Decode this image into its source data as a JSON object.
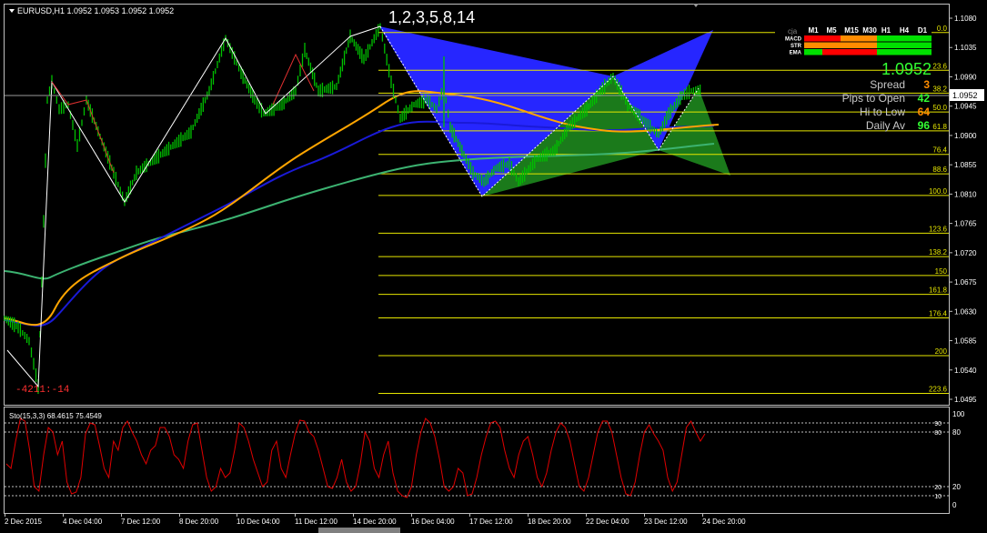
{
  "header": {
    "symbol_line": "EURUSD,H1  1.0952 1.0953 1.0952 1.0952",
    "pattern_title": "1,2,3,5,8,14",
    "zigzag_label": "-4211:-14"
  },
  "price_axis": {
    "ticks": [
      "1.1080",
      "1.1035",
      "1.0990",
      "1.0945",
      "1.0900",
      "1.0855",
      "1.0810",
      "1.0765",
      "1.0720",
      "1.0675",
      "1.0630",
      "1.0585",
      "1.0540",
      "1.0495"
    ],
    "current_price": "1.0952"
  },
  "fib_levels": [
    {
      "label": "0.0",
      "price": 1.1058
    },
    {
      "label": "23.6",
      "price": 1.1
    },
    {
      "label": "38.2",
      "price": 1.0965
    },
    {
      "label": "50.0",
      "price": 1.0936
    },
    {
      "label": "61.8",
      "price": 1.0907
    },
    {
      "label": "76.4",
      "price": 1.0871
    },
    {
      "label": "88.6",
      "price": 1.0841
    },
    {
      "label": "100.0",
      "price": 1.0808
    },
    {
      "label": "123.6",
      "price": 1.075
    },
    {
      "label": "138.2",
      "price": 1.0714
    },
    {
      "label": "150",
      "price": 1.0685
    },
    {
      "label": "161.8",
      "price": 1.0656
    },
    {
      "label": "176.4",
      "price": 1.062
    },
    {
      "label": "200",
      "price": 1.0562
    },
    {
      "label": "223.6",
      "price": 1.0504
    }
  ],
  "info_panel": {
    "big_price": "1.0952",
    "rows": [
      {
        "label": "Spread",
        "value": "3"
      },
      {
        "label": "Pips to Open",
        "value": "42"
      },
      {
        "label": "Hi to Low",
        "value": "64"
      },
      {
        "label": "Daily Av",
        "value": "96"
      }
    ]
  },
  "signal_grid": {
    "cja_label": "cja",
    "timeframes": [
      "M1",
      "M5",
      "M15",
      "M30",
      "H1",
      "H4",
      "D1"
    ],
    "rows": [
      {
        "name": "MACD",
        "cells": [
          "red",
          "red",
          "orange",
          "orange",
          "green",
          "green",
          "green"
        ]
      },
      {
        "name": "STR",
        "cells": [
          "orange",
          "orange",
          "orange",
          "orange",
          "green",
          "green",
          "green"
        ]
      },
      {
        "name": "EMA",
        "cells": [
          "green",
          "red",
          "red",
          "red",
          "green",
          "green",
          "green"
        ]
      }
    ],
    "colors": {
      "red": "#ff0000",
      "orange": "#ff8c00",
      "green": "#00e000"
    }
  },
  "time_axis": {
    "labels": [
      "2 Dec 2015",
      "4 Dec 04:00",
      "7 Dec 12:00",
      "8 Dec 20:00",
      "10 Dec 04:00",
      "11 Dec 12:00",
      "14 Dec 20:00",
      "16 Dec 04:00",
      "17 Dec 12:00",
      "18 Dec 20:00",
      "22 Dec 04:00",
      "23 Dec 12:00",
      "24 Dec 20:00"
    ]
  },
  "stochastic": {
    "label": "Sto(15,3,3) 68.4615 75.4549",
    "levels": [
      "100",
      "80",
      "20",
      "0"
    ],
    "dotted_level_labels": [
      "90",
      "80",
      "20",
      "10"
    ]
  },
  "colors": {
    "background": "#000000",
    "candle_up": "#00c000",
    "ema_fast": "#ffa500",
    "ema_mid": "#1a1ad8",
    "ema_slow": "#3cb371",
    "pattern_blue": "#2626ff",
    "pattern_green": "#1b7a1b",
    "fib_line": "#e6e600",
    "stoch_line": "#e00000",
    "text_white": "#ffffff",
    "price_green": "#33ff33"
  }
}
